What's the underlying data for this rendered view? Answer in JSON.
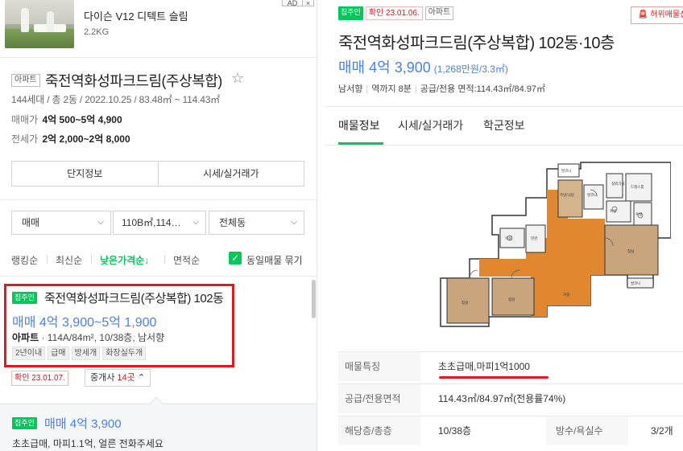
{
  "ad": {
    "title": "다이슨 V12 디텍트 슬림",
    "subtitle": "2.2KG",
    "badge": "AD",
    "close": "×"
  },
  "complex": {
    "type_tag": "아파트",
    "name": "죽전역화성파크드림(주상복합)",
    "star_icon": "☆",
    "meta": "144세대 / 총 2동 / 2022.10.25 / 83.48㎡ ~ 114.43㎡",
    "sale_label": "매매가",
    "sale_value": "4억 500~5억 4,900",
    "lease_label": "전세가",
    "lease_value": "2억 2,000~2억 8,000",
    "btn_info": "단지정보",
    "btn_price": "시세/실거래가"
  },
  "filters": {
    "trade": "매매",
    "area": "110B㎡,114…",
    "dong": "전체동"
  },
  "sort": {
    "items": [
      "랭킹순",
      "최신순",
      "낮은가격순↓",
      "면적순"
    ],
    "same_listing_label": "동일매물 묶기"
  },
  "listing1": {
    "badge": "집주인",
    "title": "죽전역화성파크드림(주상복합) 102동",
    "price": "매매 4억 3,900~5억 1,900",
    "spec_type": "아파트",
    "spec_rest": " · 114A/84m², 10/38층, 남서향",
    "tags": [
      "2년이내",
      "급매",
      "방세개",
      "화장실두개"
    ],
    "confirm": "확인 23.01.07.",
    "agents_label": "중개사 ",
    "agents_count": "14곳",
    "agents_chev": "⌃"
  },
  "listing2": {
    "badge": "집주인",
    "price": "매매 4억 3,900",
    "desc": "초초급매, 마피1.1억, 얼른 전화주세요"
  },
  "detail": {
    "badge_owner": "집주인",
    "confirm": "확인 23.01.06.",
    "type_tag": "아파트",
    "report": "허위매물신고",
    "title": "죽전역화성파크드림(주상복합) 102동·10층",
    "price": "매매 4억 3,900",
    "unit_price": "(1,268만원/3.3㎡)",
    "direction": "남서향",
    "station": "역까지 8분",
    "area": "공급/전용 면적:114.43㎡/84.97㎡",
    "tabs": [
      "매물정보",
      "시세/실거래가",
      "학군정보"
    ],
    "rows": {
      "feature_label": "매물특징",
      "feature_value": "초초급매,마피1억1000",
      "area_label": "공급/전용면적",
      "area_value": "114.43㎡/84.97㎡(전용률74%)",
      "floor_label": "해당층/총층",
      "floor_value": "10/38층",
      "rooms_label": "방수/욕실수",
      "rooms_value": "3/2개"
    }
  },
  "colors": {
    "green": "#03c75a",
    "blue_price": "#4a80e8",
    "red": "#e8141e"
  }
}
